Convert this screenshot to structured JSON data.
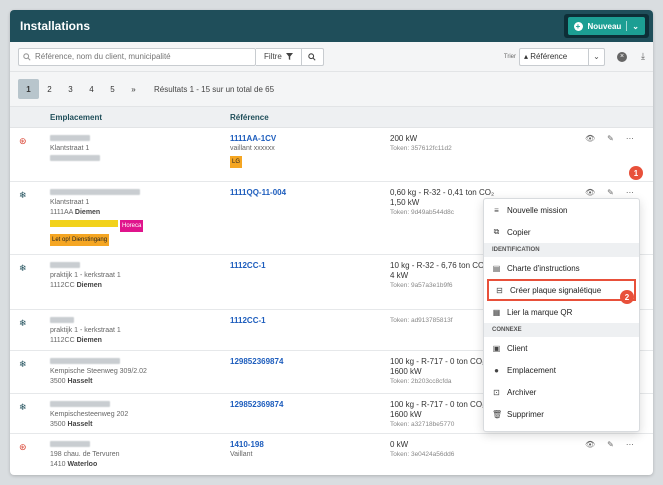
{
  "header": {
    "title": "Installations",
    "new_button": "Nouveau"
  },
  "toolbar": {
    "search_placeholder": "Référence, nom du client, municipalité",
    "filter_label": "Filtre",
    "sort_label": "Trier",
    "sort_value": "Référence"
  },
  "pager": {
    "pages": [
      "1",
      "2",
      "3",
      "4",
      "5",
      "»"
    ],
    "results": "Résultats 1 - 15 sur un total de 65"
  },
  "table": {
    "headers": {
      "location": "Emplacement",
      "reference": "Référence"
    },
    "rows": [
      {
        "l1": "Klantstraat 1",
        "ref": "1111AA-1CV",
        "ref_sub": "vaillant xxxxxx",
        "spec1": "200 kW",
        "spec2": "",
        "token": "Token: 357612fc11d2",
        "tag": "LG"
      },
      {
        "l1": "Klantstraat 1",
        "l2": "1111AA",
        "l2b": "Diemen",
        "ref": "1111QQ-11-004",
        "spec1": "0,60 kg - R-32 - 0,41 ton CO₂",
        "spec2": "1,50 kW",
        "token": "Token: 9d49ab544d8c",
        "tag_horeca": "Horeca",
        "tag_let": "Let op! Dienstingang"
      },
      {
        "l1": "praktijk 1 - kerkstraat 1",
        "l2": "1112CC",
        "l2b": "Diemen",
        "ref": "1112CC-1",
        "spec1": "10 kg - R-32 - 6,76 ton CO₂",
        "spec2": "4 kW",
        "token": "Token: 9a57a3e1b9f6"
      },
      {
        "l1": "praktijk 1 - kerkstraat 1",
        "l2": "1112CC",
        "l2b": "Diemen",
        "ref": "1112CC-1",
        "token": "Token: ad913785813f"
      },
      {
        "l1": "Kempische Steenweg 309/2.02",
        "l2": "3500",
        "l2b": "Hasselt",
        "ref": "129852369874",
        "spec1": "100 kg - R-717 - 0 ton CO₂",
        "spec2": "1600 kW",
        "token": "Token: 2b203cc8cfda"
      },
      {
        "l1": "Kempischesteenweg 202",
        "l2": "3500",
        "l2b": "Hasselt",
        "ref": "129852369874",
        "spec1": "100 kg - R-717 - 0 ton CO₂",
        "spec2": "1600 kW",
        "token": "Token: a32718be5770"
      },
      {
        "l1": "198 chau. de Tervuren",
        "l2": "1410",
        "l2b": "Waterloo",
        "ref": "1410-198",
        "ref_sub": "Vaillant",
        "spec1": "0 kW",
        "token": "Token: 3e0424a56dd6"
      }
    ]
  },
  "menu": {
    "new_mission": "Nouvelle mission",
    "copy": "Copier",
    "section_id": "IDENTIFICATION",
    "charter": "Charte d'instructions",
    "create_plate": "Créer plaque signalétique",
    "link_qr": "Lier la marque QR",
    "section_related": "CONNEXE",
    "client": "Client",
    "location": "Emplacement",
    "archive": "Archiver",
    "delete": "Supprimer"
  },
  "badges": {
    "one": "1",
    "two": "2"
  },
  "colors": {
    "header": "#1f4e5a",
    "accent": "#1c9e93",
    "link": "#1d5dbd",
    "badge": "#e8503a"
  }
}
